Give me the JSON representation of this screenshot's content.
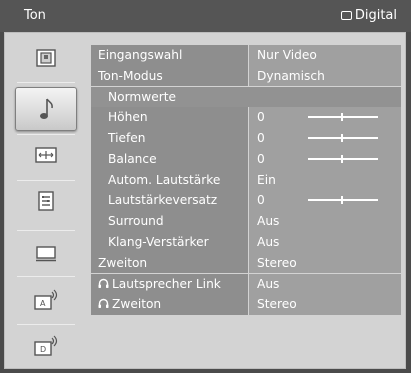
{
  "header": {
    "title": "Ton",
    "mode_label": "Digital",
    "mode_icon": "tv-screen-icon"
  },
  "sidebar": {
    "items": [
      {
        "icon": "picture-icon",
        "active": false
      },
      {
        "icon": "music-note-icon",
        "active": true
      },
      {
        "icon": "screen-format-icon",
        "active": false
      },
      {
        "icon": "settings-list-icon",
        "active": false
      },
      {
        "icon": "pc-monitor-icon",
        "active": false
      },
      {
        "icon": "analog-tuning-icon",
        "active": false
      },
      {
        "icon": "digital-tuning-icon",
        "active": false
      }
    ]
  },
  "settings": {
    "rows": [
      {
        "label": "Eingangswahl",
        "value": "Nur Video"
      },
      {
        "label": "Ton-Modus",
        "value": "Dynamisch"
      },
      {
        "label": "Normwerte"
      },
      {
        "label": "Höhen",
        "value": "0",
        "slider_level": 0.5
      },
      {
        "label": "Tiefen",
        "value": "0",
        "slider_level": 0.5
      },
      {
        "label": "Balance",
        "value": "0",
        "slider_level": 0.5
      },
      {
        "label": "Autom. Lautstärke",
        "value": "Ein"
      },
      {
        "label": "Lautstärkeversatz",
        "value": "0",
        "slider_level": 0.5
      },
      {
        "label": "Surround",
        "value": "Aus"
      },
      {
        "label": "Klang-Verstärker",
        "value": "Aus"
      },
      {
        "label": "Zweiton",
        "value": "Stereo"
      },
      {
        "label": "Lautsprecher Link",
        "value": "Aus",
        "icon": "headphones-icon"
      },
      {
        "label": "Zweiton",
        "value": "Stereo",
        "icon": "headphones-icon"
      }
    ]
  },
  "colors": {
    "background": "#4b4b4b",
    "panel": "#d3d3d3",
    "label_cell": "#8e8e8e",
    "value_cell": "#a0a0a0"
  }
}
